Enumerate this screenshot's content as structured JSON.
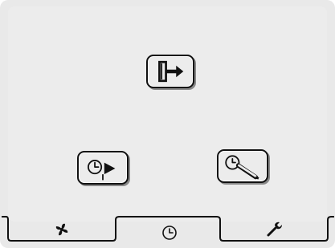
{
  "main": {
    "buttons": [
      {
        "id": "exit",
        "icon": "exit-door-arrow-icon"
      },
      {
        "id": "timer-play",
        "icon": "clock-play-icon"
      },
      {
        "id": "timer-set",
        "icon": "clock-pen-icon"
      }
    ]
  },
  "tabs": [
    {
      "id": "fan",
      "icon": "fan-icon",
      "active": false
    },
    {
      "id": "timer",
      "icon": "clock-icon",
      "active": true
    },
    {
      "id": "settings",
      "icon": "wrench-icon",
      "active": false
    }
  ],
  "colors": {
    "background": "#ececec",
    "outline": "#111111"
  }
}
